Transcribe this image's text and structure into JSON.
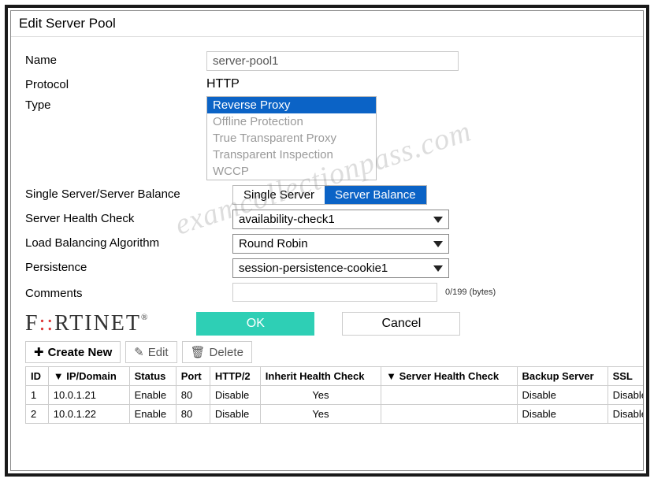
{
  "header": {
    "title": "Edit Server Pool"
  },
  "form": {
    "name_label": "Name",
    "name_value": "server-pool1",
    "protocol_label": "Protocol",
    "protocol_value": "HTTP",
    "type_label": "Type",
    "type_options": {
      "o0": "Reverse Proxy",
      "o1": "Offline Protection",
      "o2": "True Transparent Proxy",
      "o3": "Transparent Inspection",
      "o4": "WCCP"
    },
    "balance_label": "Single Server/Server Balance",
    "balance_opts": {
      "single": "Single Server",
      "balance": "Server Balance"
    },
    "health_label": "Server Health Check",
    "health_value": "availability-check1",
    "algo_label": "Load Balancing Algorithm",
    "algo_value": "Round Robin",
    "persist_label": "Persistence",
    "persist_value": "session-persistence-cookie1",
    "comments_label": "Comments",
    "comments_count": "0/199 (bytes)"
  },
  "buttons": {
    "ok": "OK",
    "cancel": "Cancel"
  },
  "toolbar": {
    "create": "Create New",
    "edit": "Edit",
    "delete": "Delete"
  },
  "table": {
    "headers": {
      "id": "ID",
      "ip": "IP/Domain",
      "status": "Status",
      "port": "Port",
      "http2": "HTTP/2",
      "inherit": "Inherit Health Check",
      "shc": "Server Health Check",
      "backup": "Backup Server",
      "ssl": "SSL"
    },
    "r0": {
      "id": "1",
      "ip": "10.0.1.21",
      "status": "Enable",
      "port": "80",
      "http2": "Disable",
      "inherit": "Yes",
      "shc": "",
      "backup": "Disable",
      "ssl": "Disable"
    },
    "r1": {
      "id": "2",
      "ip": "10.0.1.22",
      "status": "Enable",
      "port": "80",
      "http2": "Disable",
      "inherit": "Yes",
      "shc": "",
      "backup": "Disable",
      "ssl": "Disable"
    }
  },
  "logo": {
    "text_pre": "F",
    "text_post": "RTINET",
    "reg": "®"
  },
  "watermark": "examcollectionpass.com"
}
